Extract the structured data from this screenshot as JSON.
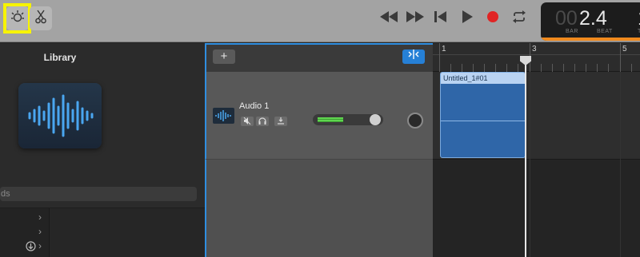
{
  "toolbar": {
    "library_icon": "library-icon",
    "smart_controls_icon": "scissors-icon",
    "transport": {
      "rewind_icon": "rewind-icon",
      "forward_icon": "fast-forward-icon",
      "to_start_icon": "go-to-start-icon",
      "play_icon": "play-icon",
      "record_icon": "record-icon",
      "cycle_icon": "cycle-icon"
    },
    "lcd": {
      "bar_dim": "00",
      "position": "2.4",
      "next_digit": "1",
      "bar_label": "BAR",
      "beat_label": "BEAT",
      "tempo_label_cut": "T"
    }
  },
  "library": {
    "title": "Library",
    "art_icon": "waveform-icon",
    "search_partial": "ds",
    "list_icons": [
      "chevron-right-icon",
      "chevron-right-icon",
      "download-icon"
    ]
  },
  "tracks": {
    "add_label": "+",
    "filter_icon": "catch-playhead-icon",
    "track": {
      "name": "Audio 1",
      "volume": 0.78,
      "buttons": [
        "mute-icon",
        "headphones-icon",
        "input-monitor-icon"
      ]
    }
  },
  "ruler": {
    "bars": [
      "1",
      "3",
      "5"
    ]
  },
  "region": {
    "name": "Untitled_1#01"
  },
  "colors": {
    "accent": "#2f8ee0",
    "region": "#2f66a8",
    "record": "#e02424",
    "lcd_orange": "#f08a1e",
    "highlight": "#f7f300"
  }
}
